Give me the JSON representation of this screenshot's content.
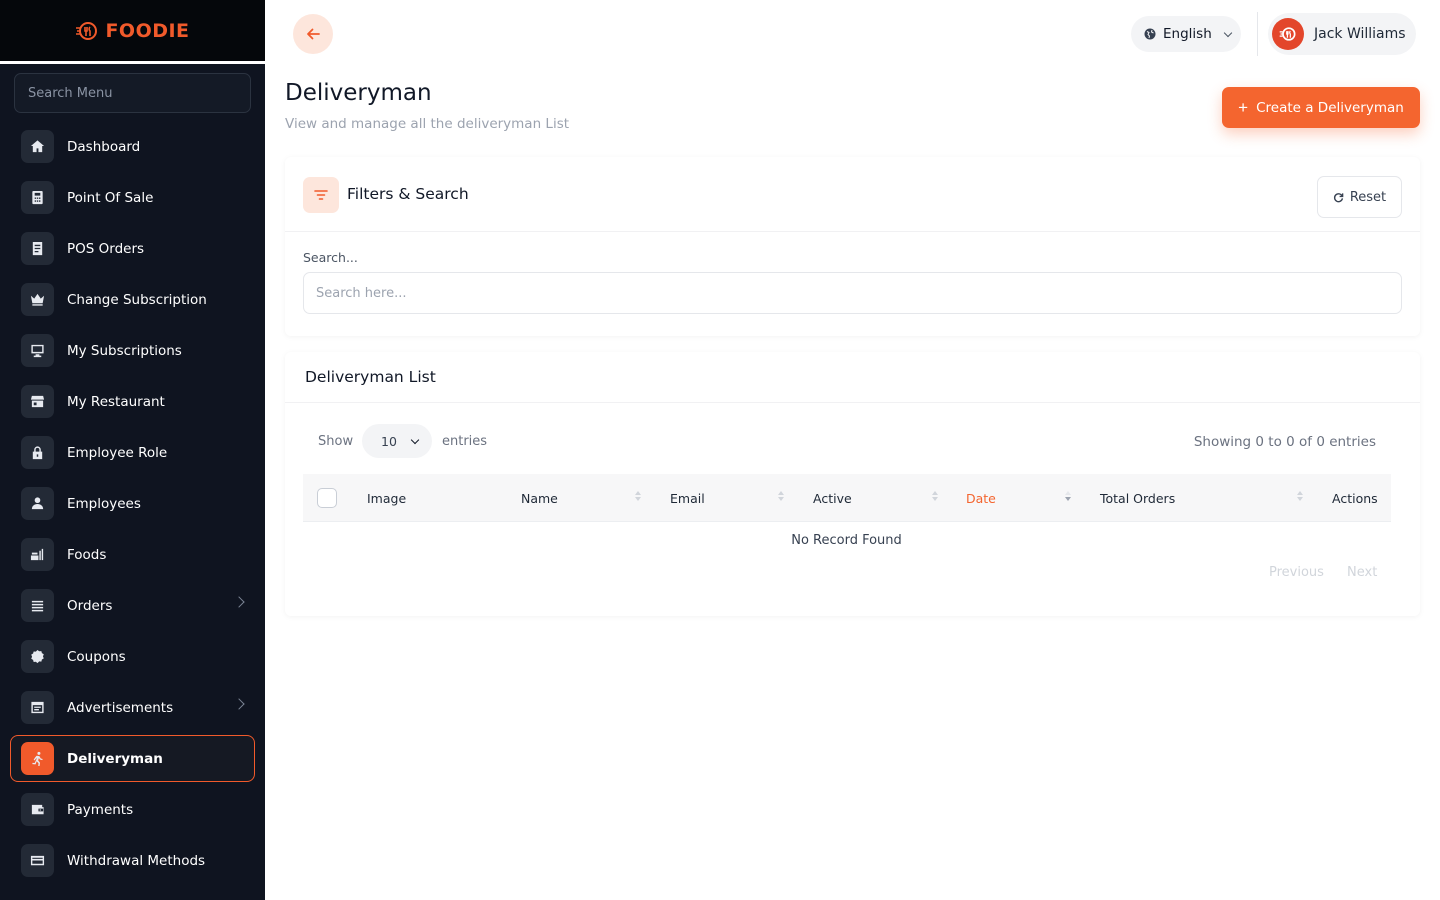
{
  "brand": {
    "name": "FOODIE",
    "accent": "#f15a2b"
  },
  "sidebar": {
    "search_placeholder": "Search Menu",
    "items": [
      {
        "label": "Dashboard",
        "icon": "home-icon"
      },
      {
        "label": "Point Of Sale",
        "icon": "calculator-icon"
      },
      {
        "label": "POS Orders",
        "icon": "receipt-icon"
      },
      {
        "label": "Change Subscription",
        "icon": "crown-icon"
      },
      {
        "label": "My Subscriptions",
        "icon": "monitor-icon"
      },
      {
        "label": "My Restaurant",
        "icon": "store-icon"
      },
      {
        "label": "Employee Role",
        "icon": "lock-icon"
      },
      {
        "label": "Employees",
        "icon": "user-icon"
      },
      {
        "label": "Foods",
        "icon": "food-icon"
      },
      {
        "label": "Orders",
        "icon": "list-icon",
        "expandable": true
      },
      {
        "label": "Coupons",
        "icon": "badge-icon"
      },
      {
        "label": "Advertisements",
        "icon": "ad-icon",
        "expandable": true
      },
      {
        "label": "Deliveryman",
        "icon": "runner-icon",
        "active": true
      },
      {
        "label": "Payments",
        "icon": "wallet-icon"
      },
      {
        "label": "Withdrawal Methods",
        "icon": "card-icon"
      }
    ]
  },
  "topbar": {
    "language": "English",
    "user_name": "Jack Williams"
  },
  "page": {
    "title": "Deliveryman",
    "subtitle": "View and manage all the deliveryman List",
    "create_label": "Create a Deliveryman"
  },
  "filters": {
    "title": "Filters & Search",
    "reset_label": "Reset",
    "search_label": "Search...",
    "search_placeholder": "Search here..."
  },
  "list": {
    "title": "Deliveryman List",
    "show_label": "Show",
    "entries_value": "10",
    "entries_label": "entries",
    "showing": "Showing 0 to 0 of 0 entries",
    "columns": [
      "Image",
      "Name",
      "Email",
      "Active",
      "Date",
      "Total Orders",
      "Actions"
    ],
    "empty_message": "No Record Found",
    "prev_label": "Previous",
    "next_label": "Next"
  }
}
